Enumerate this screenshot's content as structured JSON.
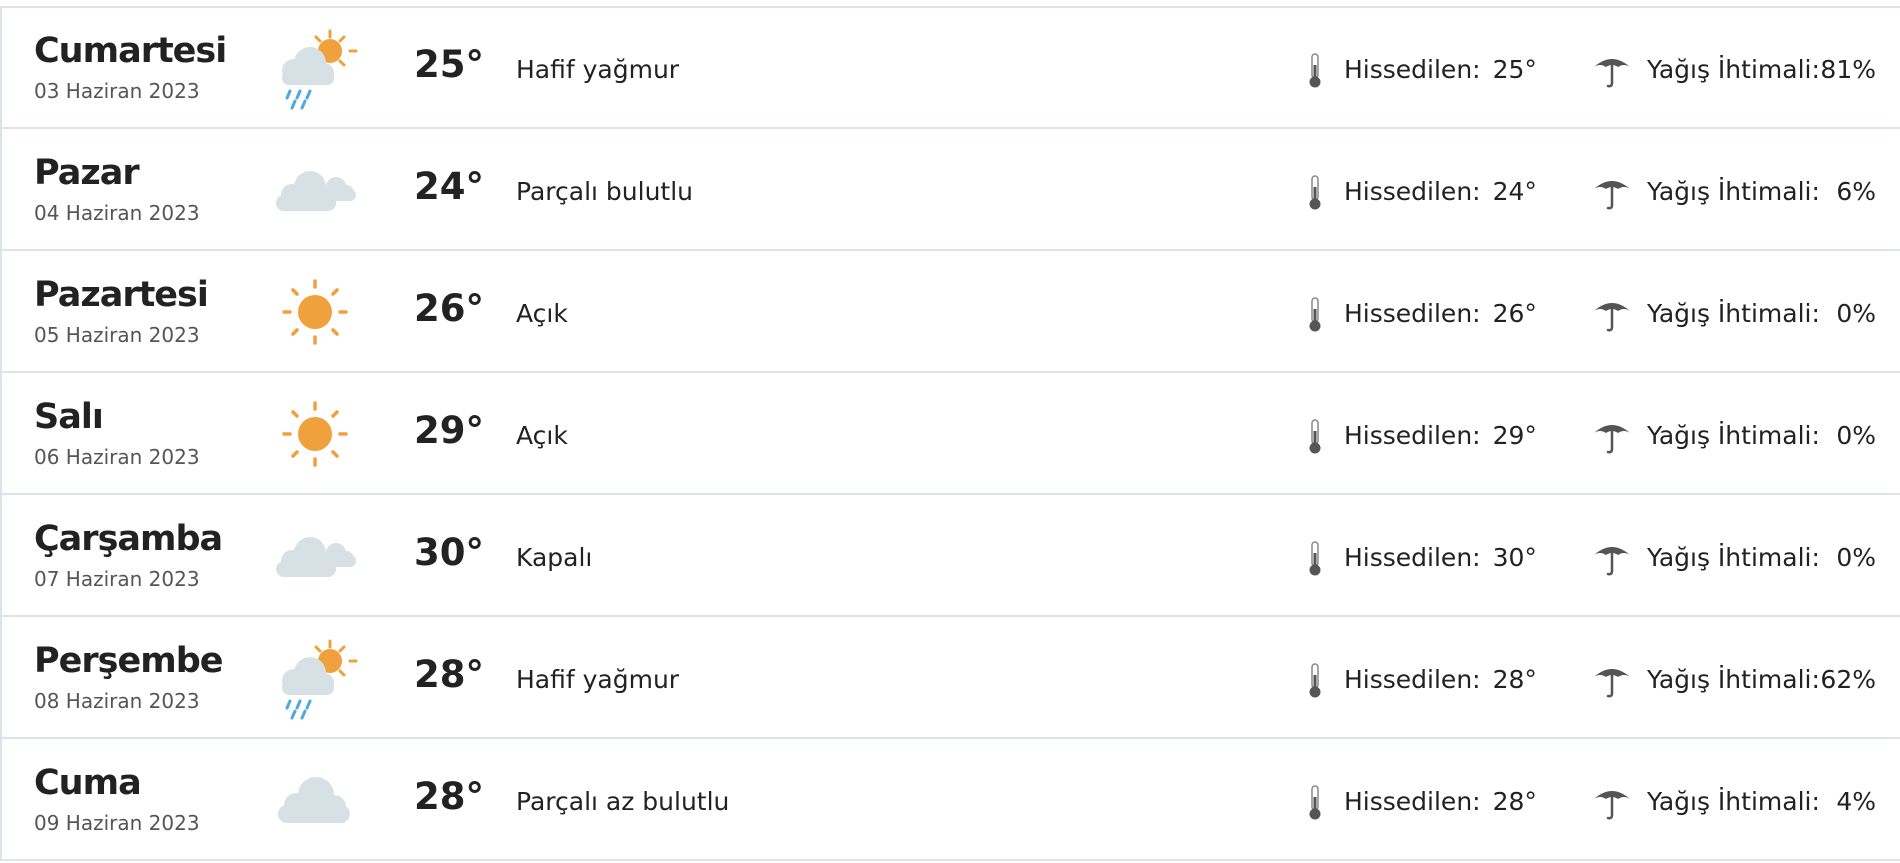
{
  "colors": {
    "sun": "#F0A03C",
    "cloud": "#D6E0E5",
    "rain": "#4FA8E0",
    "divider": "#DBE4E8",
    "icon_gray": "#555555"
  },
  "labels": {
    "feels_like": "Hissedilen:",
    "rain_chance": "Yağış İhtimali:"
  },
  "days": [
    {
      "name": "Cumartesi",
      "date": "03 Haziran 2023",
      "icon": "sun-cloud-rain-icon",
      "temp": "25°",
      "desc": "Hafif yağmur",
      "feels": "25°",
      "rain": "81%"
    },
    {
      "name": "Pazar",
      "date": "04 Haziran 2023",
      "icon": "double-cloud-icon",
      "temp": "24°",
      "desc": "Parçalı bulutlu",
      "feels": "24°",
      "rain": "6%"
    },
    {
      "name": "Pazartesi",
      "date": "05 Haziran 2023",
      "icon": "sun-icon",
      "temp": "26°",
      "desc": "Açık",
      "feels": "26°",
      "rain": "0%"
    },
    {
      "name": "Salı",
      "date": "06 Haziran 2023",
      "icon": "sun-icon",
      "temp": "29°",
      "desc": "Açık",
      "feels": "29°",
      "rain": "0%"
    },
    {
      "name": "Çarşamba",
      "date": "07 Haziran 2023",
      "icon": "double-cloud-icon",
      "temp": "30°",
      "desc": "Kapalı",
      "feels": "30°",
      "rain": "0%"
    },
    {
      "name": "Perşembe",
      "date": "08 Haziran 2023",
      "icon": "sun-cloud-rain-icon",
      "temp": "28°",
      "desc": "Hafif yağmur",
      "feels": "28°",
      "rain": "62%"
    },
    {
      "name": "Cuma",
      "date": "09 Haziran 2023",
      "icon": "cloud-icon",
      "temp": "28°",
      "desc": "Parçalı az bulutlu",
      "feels": "28°",
      "rain": "4%"
    }
  ]
}
